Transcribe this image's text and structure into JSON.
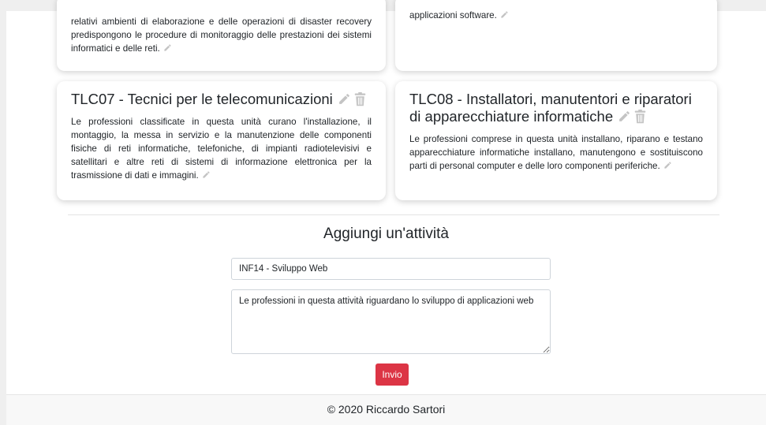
{
  "cards": {
    "top_left": {
      "text": "relativi ambienti di elaborazione e delle operazioni di disaster recovery predispongono le procedure di monitoraggio delle prestazioni dei sistemi informatici e delle reti."
    },
    "top_right": {
      "text": "applicazioni software."
    },
    "tlc07": {
      "title": "TLC07 - Tecnici per le telecomunicazioni",
      "text": "Le professioni classificate in questa unità curano l'installazione, il montaggio, la messa in servizio e la manutenzione delle componenti fisiche di reti informatiche, telefoniche, di impianti radiotelevisivi e satellitari e altre reti di sistemi di informazione elettronica per la trasmissione di dati e immagini."
    },
    "tlc08": {
      "title": "TLC08 - Installatori, manutentori e riparatori di apparecchiature informatiche",
      "text": "Le professioni comprese in questa unità installano, riparano e testano apparecchiature informatiche installano, manutengono e sostituiscono parti di personal computer e delle loro componenti periferiche."
    }
  },
  "form": {
    "heading": "Aggiungi un'attività",
    "title_value": "INF14 - Sviluppo Web",
    "description_value": "Le professioni in questa attività riguardano lo sviluppo di applicazioni web",
    "submit_label": "Invio"
  },
  "footer": {
    "text": "© 2020 Riccardo Sartori"
  },
  "icons": {
    "edit": "pencil-icon",
    "delete": "trash-icon"
  },
  "colors": {
    "accent": "#dc3545",
    "icon_gray": "#c4c4c4"
  }
}
